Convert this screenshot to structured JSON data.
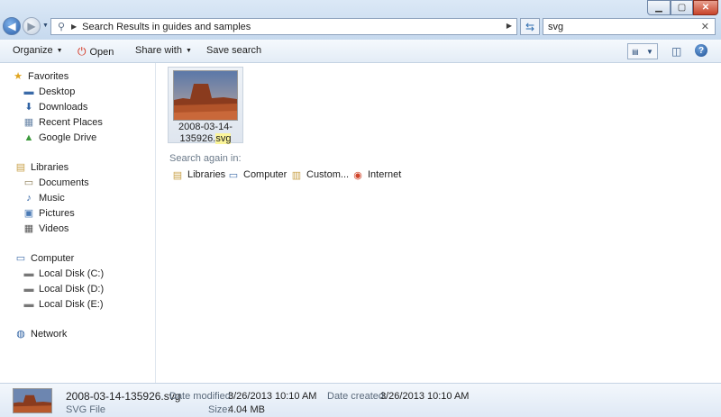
{
  "address": {
    "breadcrumb": "Search Results in guides and samples"
  },
  "search": {
    "query": "svg"
  },
  "toolbar": {
    "organize": "Organize",
    "open": "Open",
    "share_with": "Share with",
    "save_search": "Save search"
  },
  "nav": {
    "favorites": {
      "label": "Favorites",
      "items": [
        "Desktop",
        "Downloads",
        "Recent Places",
        "Google Drive"
      ]
    },
    "libraries": {
      "label": "Libraries",
      "items": [
        "Documents",
        "Music",
        "Pictures",
        "Videos"
      ]
    },
    "computer": {
      "label": "Computer",
      "items": [
        "Local Disk (C:)",
        "Local Disk (D:)",
        "Local Disk (E:)"
      ]
    },
    "network": {
      "label": "Network"
    }
  },
  "result": {
    "name_line1": "2008-03-14-",
    "name_line2_prefix": "135926.",
    "name_line2_match": "svg"
  },
  "search_again": {
    "label": "Search again in:",
    "options": [
      "Libraries",
      "Computer",
      "Custom...",
      "Internet"
    ]
  },
  "details": {
    "file_name": "2008-03-14-135926.svg",
    "file_type": "SVG File",
    "date_modified_label": "Date modified:",
    "date_modified": "3/26/2013 10:10 AM",
    "date_created_label": "Date created:",
    "date_created": "3/26/2013 10:10 AM",
    "size_label": "Size:",
    "size": "4.04 MB"
  },
  "icons": {
    "back": "back-arrow-icon",
    "forward": "forward-arrow-icon",
    "refresh": "refresh-icon",
    "search": "search-icon",
    "open": "power-open-icon",
    "help": "help-icon"
  },
  "colors": {
    "accent": "#2a5ea8",
    "highlight": "#fbf59a"
  }
}
